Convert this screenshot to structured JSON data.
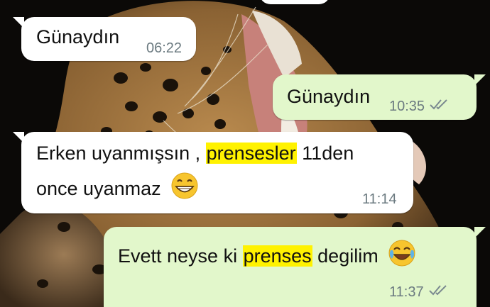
{
  "chat": {
    "messages": [
      {
        "direction": "incoming",
        "text": "Günaydın",
        "time": "06:22"
      },
      {
        "direction": "outgoing",
        "text": "Günaydın",
        "time": "10:35",
        "status": "read-double-check-icon"
      },
      {
        "direction": "incoming",
        "line1_before": "Erken uyanmışsın , ",
        "line1_highlight": "prensesler",
        "line1_after": " 11den",
        "line2": "once uyanmaz",
        "emoji": "grinning-face-icon",
        "time": "11:14"
      },
      {
        "direction": "outgoing",
        "before": "Evett  neyse ki ",
        "highlight": "prenses",
        "after": " degilim",
        "emoji": "tears-of-joy-icon",
        "time": "11:37",
        "status": "read-double-check-icon"
      }
    ]
  },
  "colors": {
    "incoming_bubble": "#ffffff",
    "outgoing_bubble": "#e2f7cb",
    "highlight": "#fff200",
    "timestamp": "#6b7a80",
    "read_ticks": "#7b8a90"
  },
  "wallpaper": {
    "description_icon": "leopard-wallpaper-icon"
  }
}
